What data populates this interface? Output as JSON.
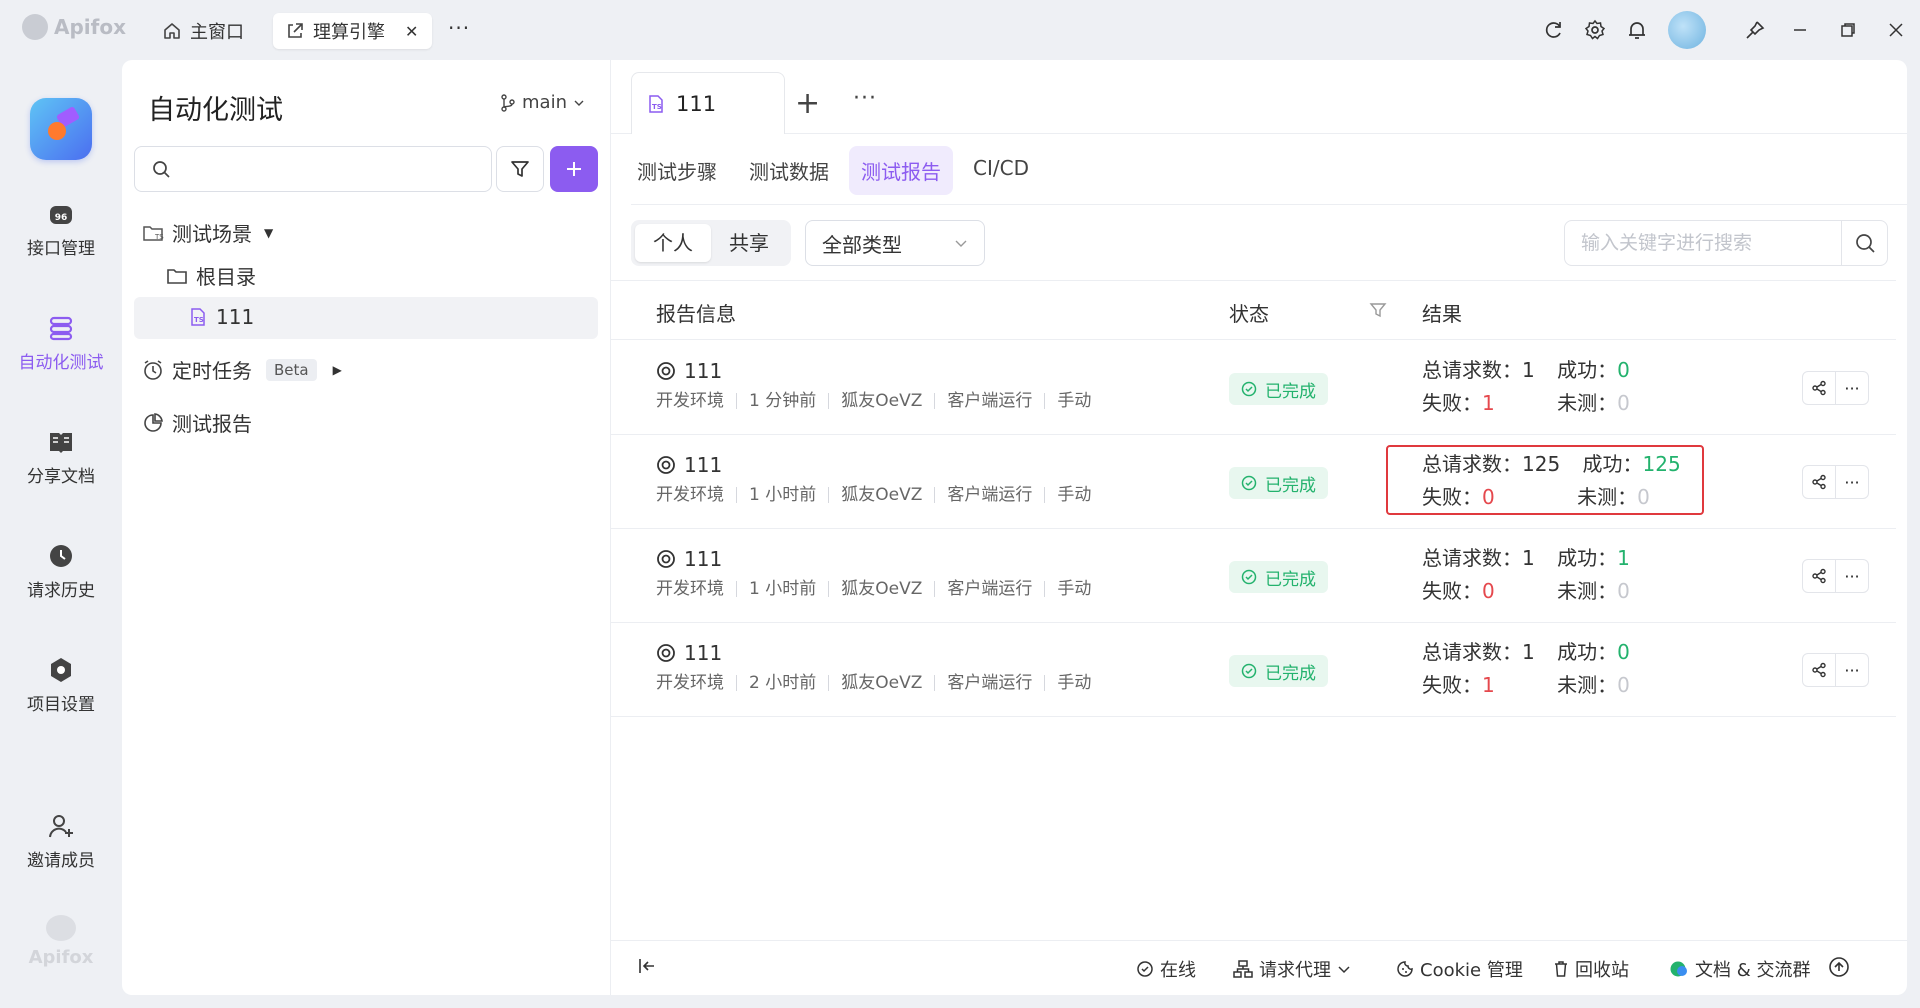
{
  "titlebar": {
    "brand": "Apifox",
    "home_tab": "主窗口",
    "active_tab": "理算引擎"
  },
  "leftnav": {
    "items": [
      {
        "label": "接口管理",
        "icon": "api-icon"
      },
      {
        "label": "自动化测试",
        "icon": "automation-icon"
      },
      {
        "label": "分享文档",
        "icon": "book-icon"
      },
      {
        "label": "请求历史",
        "icon": "clock-icon"
      },
      {
        "label": "项目设置",
        "icon": "settings-icon"
      },
      {
        "label": "邀请成员",
        "icon": "user-add-icon"
      }
    ],
    "bottom_brand": "Apifox"
  },
  "tree": {
    "title": "自动化测试",
    "branch": "main",
    "search_placeholder": "",
    "scenarios_label": "测试场景",
    "root_label": "根目录",
    "case_label": "111",
    "scheduled_label": "定时任务",
    "beta": "Beta",
    "reports_label": "测试报告"
  },
  "main": {
    "tab_label": "111",
    "subtabs": [
      "测试步骤",
      "测试数据",
      "测试报告",
      "CI/CD"
    ],
    "segment": [
      "个人",
      "共享"
    ],
    "type_select": "全部类型",
    "search_placeholder": "输入关键字进行搜索",
    "headers": {
      "info": "报告信息",
      "status": "状态",
      "result": "结果"
    },
    "rows": [
      {
        "name": "111",
        "env": "开发环境",
        "time": "1 分钟前",
        "user": "狐友OeVZ",
        "runner": "客户端运行",
        "mode": "手动",
        "status": "已完成",
        "total_label": "总请求数：",
        "total": "1",
        "success_label": "成功：",
        "success": "0",
        "fail_label": "失败：",
        "fail": "1",
        "untested_label": "未测：",
        "untested": "0"
      },
      {
        "name": "111",
        "env": "开发环境",
        "time": "1 小时前",
        "user": "狐友OeVZ",
        "runner": "客户端运行",
        "mode": "手动",
        "status": "已完成",
        "total_label": "总请求数：",
        "total": "125",
        "success_label": "成功：",
        "success": "125",
        "fail_label": "失败：",
        "fail": "0",
        "untested_label": "未测：",
        "untested": "0"
      },
      {
        "name": "111",
        "env": "开发环境",
        "time": "1 小时前",
        "user": "狐友OeVZ",
        "runner": "客户端运行",
        "mode": "手动",
        "status": "已完成",
        "total_label": "总请求数：",
        "total": "1",
        "success_label": "成功：",
        "success": "1",
        "fail_label": "失败：",
        "fail": "0",
        "untested_label": "未测：",
        "untested": "0"
      },
      {
        "name": "111",
        "env": "开发环境",
        "time": "2 小时前",
        "user": "狐友OeVZ",
        "runner": "客户端运行",
        "mode": "手动",
        "status": "已完成",
        "total_label": "总请求数：",
        "total": "1",
        "success_label": "成功：",
        "success": "0",
        "fail_label": "失败：",
        "fail": "1",
        "untested_label": "未测：",
        "untested": "0"
      }
    ]
  },
  "footer": {
    "online": "在线",
    "proxy": "请求代理",
    "cookie": "Cookie 管理",
    "trash": "回收站",
    "docs": "文档 & 交流群"
  },
  "colors": {
    "accent": "#8c5cf0",
    "success": "#23b26d",
    "danger": "#e5484d",
    "highlight": "#e0393e"
  }
}
